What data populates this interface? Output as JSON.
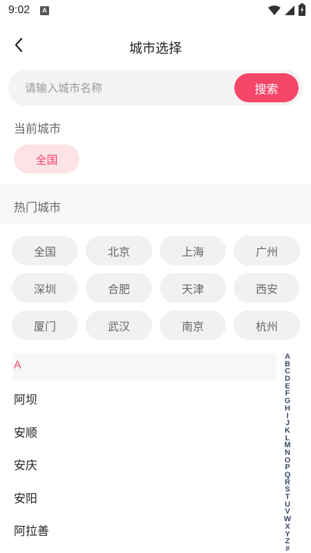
{
  "status_bar": {
    "time": "9:02",
    "notification_badge": "A",
    "icons": [
      "wifi-icon",
      "signal-icon",
      "battery-charging-icon"
    ]
  },
  "header": {
    "title": "城市选择",
    "back_icon": "chevron-left-icon"
  },
  "search": {
    "placeholder": "请输入城市名称",
    "value": "",
    "button_label": "搜索"
  },
  "current_city": {
    "label": "当前城市",
    "value": "全国"
  },
  "hot_cities": {
    "label": "热门城市",
    "items": [
      "全国",
      "北京",
      "上海",
      "广州",
      "深圳",
      "合肥",
      "天津",
      "西安",
      "厦门",
      "武汉",
      "南京",
      "杭州"
    ]
  },
  "city_list": {
    "letter": "A",
    "items": [
      "阿坝",
      "安顺",
      "安庆",
      "安阳",
      "阿拉善"
    ]
  },
  "alphabet_index": [
    "A",
    "B",
    "C",
    "D",
    "E",
    "F",
    "G",
    "H",
    "I",
    "J",
    "K",
    "L",
    "M",
    "N",
    "O",
    "P",
    "Q",
    "R",
    "S",
    "T",
    "U",
    "V",
    "W",
    "X",
    "Y",
    "Z",
    "#"
  ],
  "colors": {
    "accent": "#f5466a",
    "accent_light": "#fde3e6",
    "chip_bg": "#f1f1f1",
    "index_text": "#3b4a6b"
  }
}
